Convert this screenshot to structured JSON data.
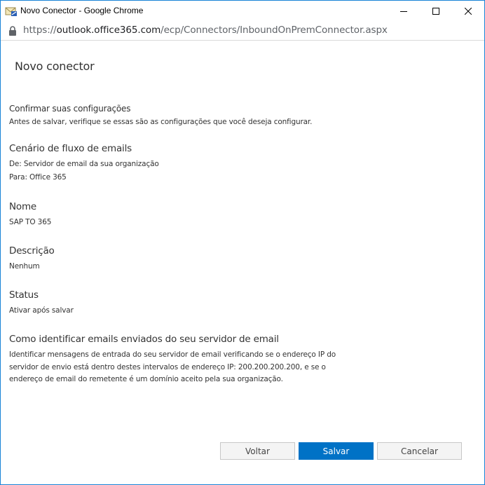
{
  "window": {
    "title": "Novo Conector - Google Chrome"
  },
  "address_bar": {
    "scheme": "https://",
    "host": "outlook.office365.com",
    "path": "/ecp/Connectors/InboundOnPremConnector.aspx"
  },
  "page": {
    "title": "Novo conector",
    "confirm_heading": "Confirmar suas configurações",
    "confirm_description": "Antes de salvar, verifique se essas são as configurações que você deseja configurar."
  },
  "sections": {
    "flow": {
      "heading": "Cenário de fluxo de emails",
      "from": "De: Servidor de email da sua organização",
      "to": "Para: Office 365"
    },
    "name": {
      "heading": "Nome",
      "value": "SAP TO 365"
    },
    "description": {
      "heading": "Descrição",
      "value": "Nenhum"
    },
    "status": {
      "heading": "Status",
      "value": "Ativar após salvar"
    },
    "identify": {
      "heading": "Como identificar emails enviados do seu servidor de email",
      "text": "Identificar mensagens de entrada do seu servidor de email verificando se o endereço IP do servidor de envio está dentro destes intervalos de endereço IP: 200.200.200.200, e se o endereço de email do remetente é um domínio aceito pela sua organização."
    }
  },
  "buttons": {
    "back": "Voltar",
    "save": "Salvar",
    "cancel": "Cancelar"
  },
  "colors": {
    "accent": "#0072c6",
    "window_border": "#1883d7"
  },
  "icons": {
    "app": "outlook-envelope-icon",
    "lock": "lock-icon",
    "minimize": "minimize-icon",
    "maximize": "maximize-icon",
    "close": "close-icon"
  }
}
